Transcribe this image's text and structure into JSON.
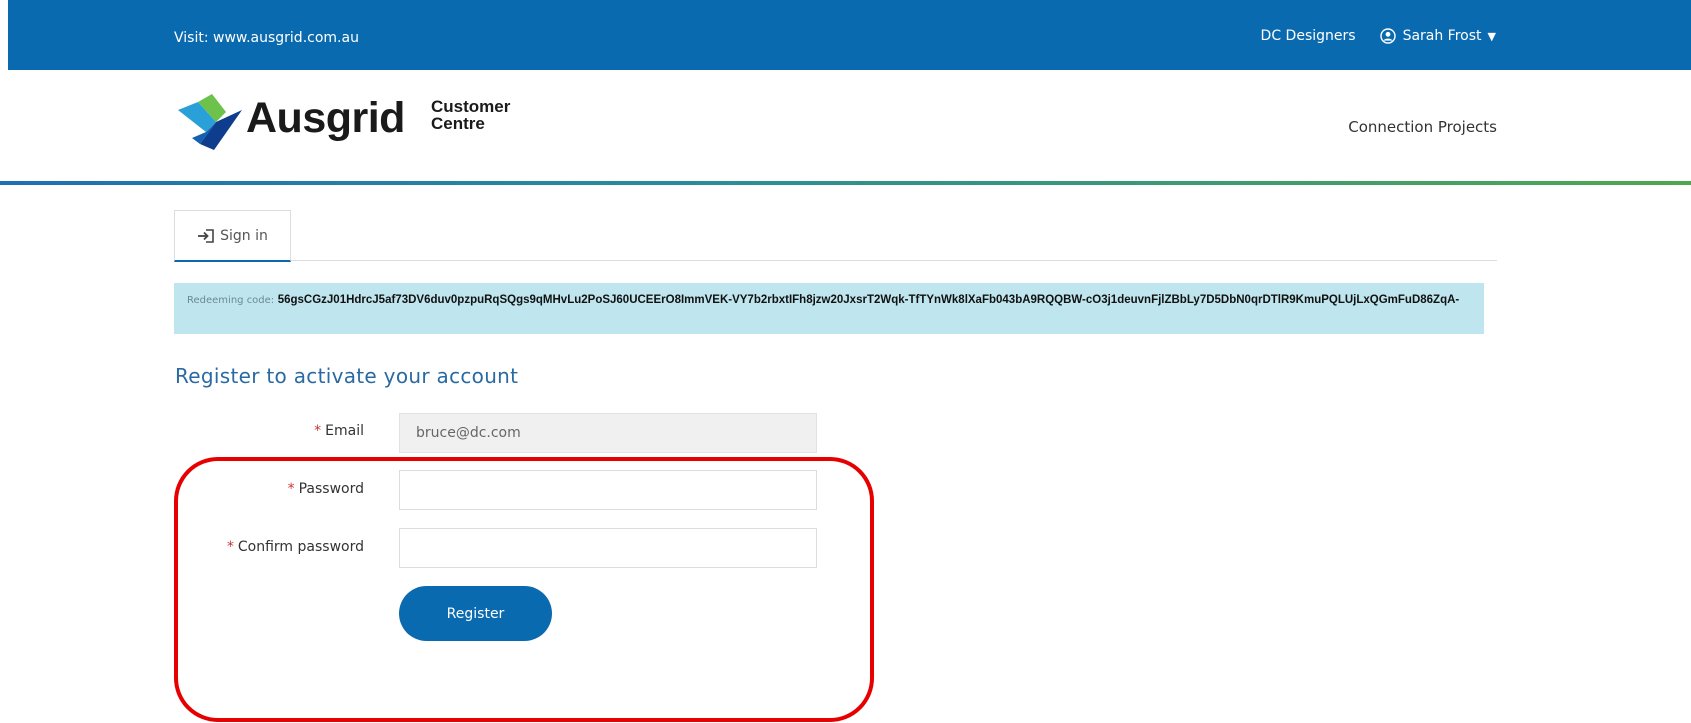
{
  "topbar": {
    "visit_label": "Visit:",
    "visit_url": "www.ausgrid.com.au",
    "org": "DC Designers",
    "user": "Sarah Frost",
    "user_icon": "user-circle-icon",
    "caret_icon": "caret-down-icon",
    "background": "#0a6ab0"
  },
  "header": {
    "logo_word": "Ausgrid",
    "logo_sub1": "Customer",
    "logo_sub2": "Centre",
    "nav_link": "Connection Projects"
  },
  "tabs": [
    {
      "label": "Sign in",
      "icon": "sign-in-icon"
    }
  ],
  "alert": {
    "label": "Redeeming code:",
    "code": "56gsCGzJ01HdrcJ5af73DV6duv0pzpuRqSQgs9qMHvLu2PoSJ60UCEErO8ImmVEK-VY7b2rbxtIFh8jzw20JxsrT2Wqk-TfTYnWk8lXaFb043bA9RQQBW-cO3j1deuvnFjlZBbLy7D5DbN0qrDTlR9KmuPQLUjLxQGmFuD86ZqA-",
    "background": "#bfe6ef"
  },
  "form": {
    "title": "Register to activate your account",
    "required_mark": "*",
    "email_label": "Email",
    "email_value": "bruce@dc.com",
    "password_label": "Password",
    "password_value": "",
    "confirm_label": "Confirm password",
    "confirm_value": "",
    "submit_label": "Register"
  },
  "colors": {
    "primary": "#0a6ab0",
    "required": "#cc3333",
    "highlight": "#e60000"
  }
}
